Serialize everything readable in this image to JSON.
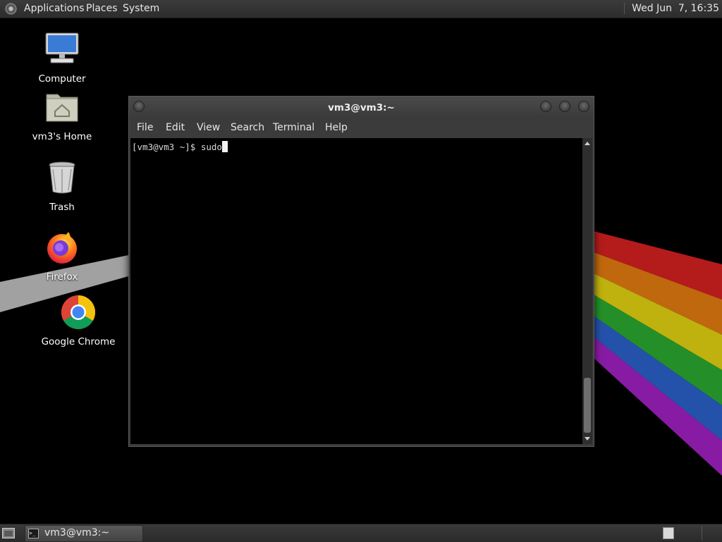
{
  "top_panel": {
    "menus": [
      "Applications",
      "Places",
      "System"
    ],
    "clock": "Wed Jun  7, 16:35"
  },
  "desktop": {
    "icons": [
      {
        "label": "Computer",
        "icon": "computer-icon"
      },
      {
        "label": "vm3's Home",
        "icon": "home-folder-icon"
      },
      {
        "label": "Trash",
        "icon": "trash-icon"
      },
      {
        "label": "Firefox",
        "icon": "firefox-icon"
      },
      {
        "label": "Google Chrome",
        "icon": "chrome-icon"
      }
    ]
  },
  "terminal": {
    "title": "vm3@vm3:~",
    "menu": [
      "File",
      "Edit",
      "View",
      "Search",
      "Terminal",
      "Help"
    ],
    "prompt": "[vm3@vm3 ~]$ ",
    "input": "sudo"
  },
  "bottom_panel": {
    "task_label": "vm3@vm3:~",
    "task_icon": "terminal-icon"
  },
  "colors": {
    "rainbow": [
      "#d42020",
      "#e07a10",
      "#e0d010",
      "#2aa830",
      "#2a60c8",
      "#a020c0"
    ]
  }
}
